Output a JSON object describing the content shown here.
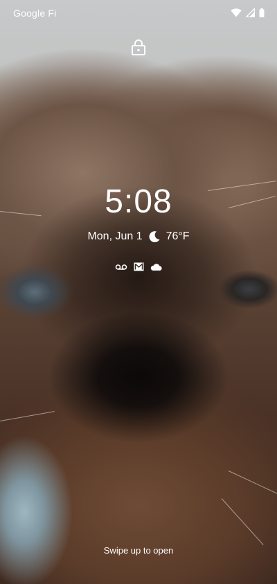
{
  "status_bar": {
    "carrier": "Google Fi",
    "icons": [
      "wifi-icon",
      "cell-signal-icon",
      "battery-icon"
    ]
  },
  "lock_screen": {
    "lock_icon": "lock-icon",
    "time": "5:08",
    "date": "Mon, Jun 1",
    "weather_icon": "moon-icon",
    "temperature": "76°F",
    "notification_icons": [
      "voicemail-icon",
      "gmail-icon",
      "cloud-icon"
    ],
    "hint": "Swipe up to open"
  },
  "colors": {
    "text": "#ffffff"
  }
}
